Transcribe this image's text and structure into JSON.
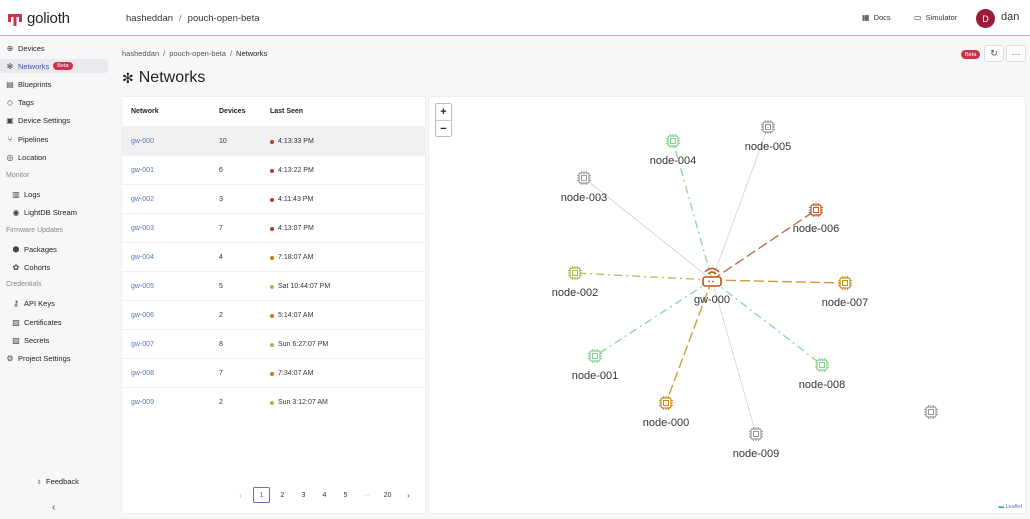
{
  "topbar": {
    "brand": "golioth",
    "org": "hasheddan",
    "project": "pouch-open-beta",
    "docs_label": "Docs",
    "simulator_label": "Simulator",
    "user_initial": "D",
    "user_name": "dan"
  },
  "sidebar": {
    "items": [
      {
        "label": "Devices",
        "icon": "devices-icon"
      },
      {
        "label": "Networks",
        "icon": "network-icon",
        "badge": "Beta",
        "active": true
      },
      {
        "label": "Blueprints",
        "icon": "blueprint-icon"
      },
      {
        "label": "Tags",
        "icon": "tag-icon"
      },
      {
        "label": "Device Settings",
        "icon": "settings-icon"
      },
      {
        "label": "Pipelines",
        "icon": "pipeline-icon"
      },
      {
        "label": "Location",
        "icon": "location-icon"
      }
    ],
    "monitor_section": "Monitor",
    "monitor_items": [
      {
        "label": "Logs",
        "icon": "logs-icon"
      },
      {
        "label": "LightDB Stream",
        "icon": "stream-icon"
      }
    ],
    "firmware_section": "Firmware Updates",
    "firmware_items": [
      {
        "label": "Packages",
        "icon": "package-icon"
      },
      {
        "label": "Cohorts",
        "icon": "cohort-icon"
      }
    ],
    "credentials_section": "Credentials",
    "credentials_items": [
      {
        "label": "API Keys",
        "icon": "key-icon"
      },
      {
        "label": "Certificates",
        "icon": "certificate-icon"
      },
      {
        "label": "Secrets",
        "icon": "lock-icon"
      }
    ],
    "project_settings": "Project Settings",
    "feedback": "Feedback"
  },
  "breadcrumb": {
    "org": "hasheddan",
    "project": "pouch-open-beta",
    "current": "Networks"
  },
  "page": {
    "title": "Networks",
    "beta_badge": "Beta"
  },
  "table": {
    "headers": {
      "network": "Network",
      "devices": "Devices",
      "last_seen": "Last Seen"
    },
    "rows": [
      {
        "network": "gw-000",
        "devices": "10",
        "last_seen": "4:13:33 PM",
        "dot": "#c0392b"
      },
      {
        "network": "gw-001",
        "devices": "6",
        "last_seen": "4:13:22 PM",
        "dot": "#c0392b"
      },
      {
        "network": "gw-002",
        "devices": "3",
        "last_seen": "4:11:43 PM",
        "dot": "#c0392b"
      },
      {
        "network": "gw-003",
        "devices": "7",
        "last_seen": "4:13:07 PM",
        "dot": "#c0392b"
      },
      {
        "network": "gw-004",
        "devices": "4",
        "last_seen": "7:18:07 AM",
        "dot": "#d4700e"
      },
      {
        "network": "gw-005",
        "devices": "5",
        "last_seen": "Sat 10:44:07 PM",
        "dot": "#a8b840"
      },
      {
        "network": "gw-006",
        "devices": "2",
        "last_seen": "5:14:07 AM",
        "dot": "#d4700e"
      },
      {
        "network": "gw-007",
        "devices": "8",
        "last_seen": "Sun 6:27:07 PM",
        "dot": "#a8b840"
      },
      {
        "network": "gw-008",
        "devices": "7",
        "last_seen": "7:34:07 AM",
        "dot": "#d4700e"
      },
      {
        "network": "gw-009",
        "devices": "2",
        "last_seen": "Sun 3:12:07 AM",
        "dot": "#a8b840"
      }
    ]
  },
  "pagination": {
    "pages": [
      "1",
      "2",
      "3",
      "4",
      "5",
      "···",
      "20"
    ],
    "current": "1"
  },
  "map": {
    "gateway": "gw-000",
    "zoom_in": "+",
    "zoom_out": "−",
    "attribution": "Leaflet",
    "nodes": [
      {
        "label": "node-000",
        "color": "#c98a1c"
      },
      {
        "label": "node-001",
        "color": "#7fd28e"
      },
      {
        "label": "node-002",
        "color": "#a8b840"
      },
      {
        "label": "node-003",
        "color": "#999999"
      },
      {
        "label": "node-004",
        "color": "#7fd28e"
      },
      {
        "label": "node-005",
        "color": "#999999"
      },
      {
        "label": "node-006",
        "color": "#c0521c"
      },
      {
        "label": "node-007",
        "color": "#c98a1c"
      },
      {
        "label": "node-008",
        "color": "#7fd28e"
      },
      {
        "label": "node-009",
        "color": "#999999"
      }
    ]
  },
  "colors": {
    "accent": "#c8344f",
    "link": "#5577bb",
    "gateway": "#c0521c"
  }
}
